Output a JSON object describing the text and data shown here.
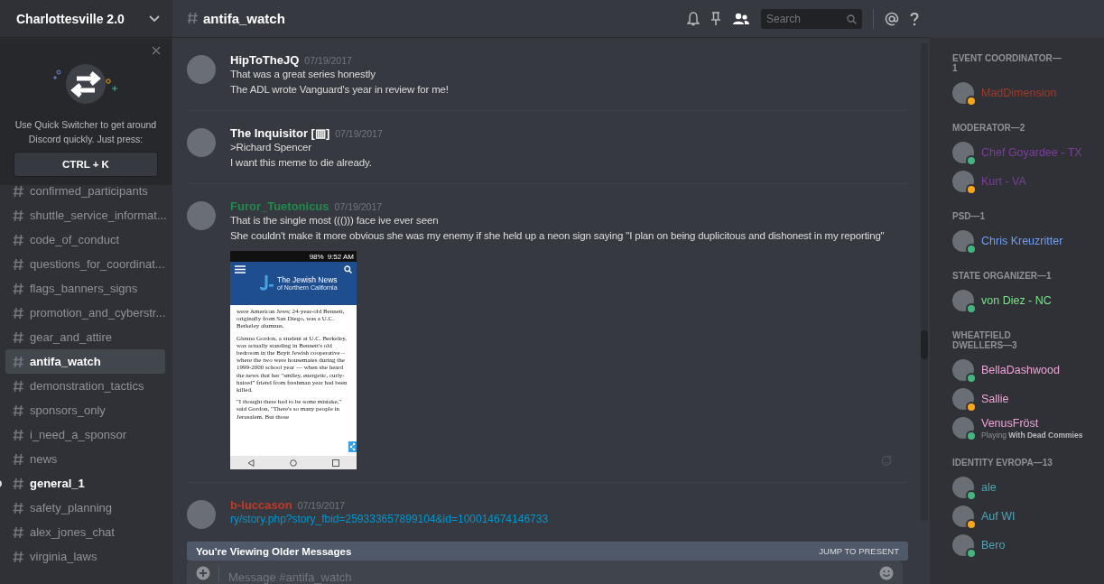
{
  "server": {
    "name": "Charlottesville 2.0"
  },
  "quick_switcher": {
    "text": "Use Quick Switcher to get around Discord quickly. Just press:",
    "shortcut": "CTRL + K"
  },
  "channels": [
    {
      "name": "confirmed_participants",
      "selected": false,
      "unread": false
    },
    {
      "name": "shuttle_service_informat...",
      "selected": false,
      "unread": false
    },
    {
      "name": "code_of_conduct",
      "selected": false,
      "unread": false
    },
    {
      "name": "questions_for_coordinat...",
      "selected": false,
      "unread": false
    },
    {
      "name": "flags_banners_signs",
      "selected": false,
      "unread": false
    },
    {
      "name": "promotion_and_cyberstr...",
      "selected": false,
      "unread": false
    },
    {
      "name": "gear_and_attire",
      "selected": false,
      "unread": false
    },
    {
      "name": "antifa_watch",
      "selected": true,
      "unread": false
    },
    {
      "name": "demonstration_tactics",
      "selected": false,
      "unread": false
    },
    {
      "name": "sponsors_only",
      "selected": false,
      "unread": false
    },
    {
      "name": "i_need_a_sponsor",
      "selected": false,
      "unread": false
    },
    {
      "name": "news",
      "selected": false,
      "unread": false
    },
    {
      "name": "general_1",
      "selected": false,
      "unread": true
    },
    {
      "name": "safety_planning",
      "selected": false,
      "unread": false
    },
    {
      "name": "alex_jones_chat",
      "selected": false,
      "unread": false
    },
    {
      "name": "virginia_laws",
      "selected": false,
      "unread": false
    }
  ],
  "header": {
    "channel": "antifa_watch",
    "search_placeholder": "Search"
  },
  "messages": [
    {
      "author": "HipToTheJQ",
      "color": "#ffffff",
      "time": "07/19/2017",
      "lines": [
        "That was a great series honestly",
        "The ADL wrote Vanguard's year in review for me!"
      ]
    },
    {
      "author": "The Inquisitor [▥]",
      "color": "#ffffff",
      "time": "07/19/2017",
      "lines": [
        ">Richard Spencer",
        "I want this meme to die already."
      ]
    },
    {
      "author": "Furor_Tuetonicus",
      "color": "#1f8b4c",
      "time": "07/19/2017",
      "lines": [
        "That is the single most ((())) face ive ever seen",
        "She couldn't make it more obvious she was my enemy if she held up a neon sign saying \"I plan on being duplicitous and dishonest in my reporting\""
      ],
      "attachment": {
        "battery": "98%",
        "clock": "9:52 AM",
        "site_title": "The Jewish News",
        "site_subtitle": "of Northern California",
        "paragraphs": [
          "were American Jews; 24-year-old Bennett, originally from San Diego, was a U.C. Berkeley alumnus.",
          "Glenna Gordon, a student at U.C. Berkeley, was actually standing in Bennett's old bedroom in the Bayit Jewish cooperative –where the two were housemates during the 1999-2000 school year — when she heard the news that her \"smiley, energetic, curly-haired\" friend from freshman year had been killed.",
          "\"I thought there had to be some mistake,\" said Gordon, \"There's so many people in Jerusalem. But those"
        ]
      }
    },
    {
      "author": "b-luccason",
      "color": "#c0392b",
      "time": "07/19/2017",
      "link": "ry/story.php?story_fbid=259333657899104&id=100014674146733"
    }
  ],
  "older_messages_bar": {
    "text": "You're Viewing Older Messages",
    "action": "JUMP TO PRESENT"
  },
  "composer": {
    "placeholder": "Message #antifa_watch"
  },
  "member_groups": [
    {
      "title": "EVENT COORDINATOR—1",
      "members": [
        {
          "name": "MadDimension",
          "color": "#a03a2c",
          "idle": true
        }
      ]
    },
    {
      "title": "MODERATOR—2",
      "members": [
        {
          "name": "Chef Goyardee - TX",
          "color": "#7b3f9a",
          "idle": false
        },
        {
          "name": "Kurt - VA",
          "color": "#7b3f9a",
          "idle": true
        }
      ]
    },
    {
      "title": "PSD—1",
      "members": [
        {
          "name": "Chris Kreuzritter",
          "color": "#6e9ff5",
          "idle": false
        }
      ]
    },
    {
      "title": "STATE ORGANIZER—1",
      "members": [
        {
          "name": "von Diez - NC",
          "color": "#7ee08a",
          "idle": false
        }
      ]
    },
    {
      "title": "WHEATFIELD DWELLERS—3",
      "members": [
        {
          "name": "BellaDashwood",
          "color": "#f0a4d8",
          "idle": false
        },
        {
          "name": "Sallie",
          "color": "#f0a4d8",
          "idle": true
        },
        {
          "name": "VenusFröst",
          "color": "#f0a4d8",
          "idle": false,
          "activity": "Playing **With Dead Commies**"
        }
      ]
    },
    {
      "title": "IDENTITY EVROPA—13",
      "members": [
        {
          "name": "ale",
          "color": "#4fa5b5",
          "idle": false
        },
        {
          "name": "Auf WI",
          "color": "#4fa5b5",
          "idle": true
        },
        {
          "name": "Bero",
          "color": "#4fa5b5",
          "idle": false
        }
      ]
    }
  ]
}
